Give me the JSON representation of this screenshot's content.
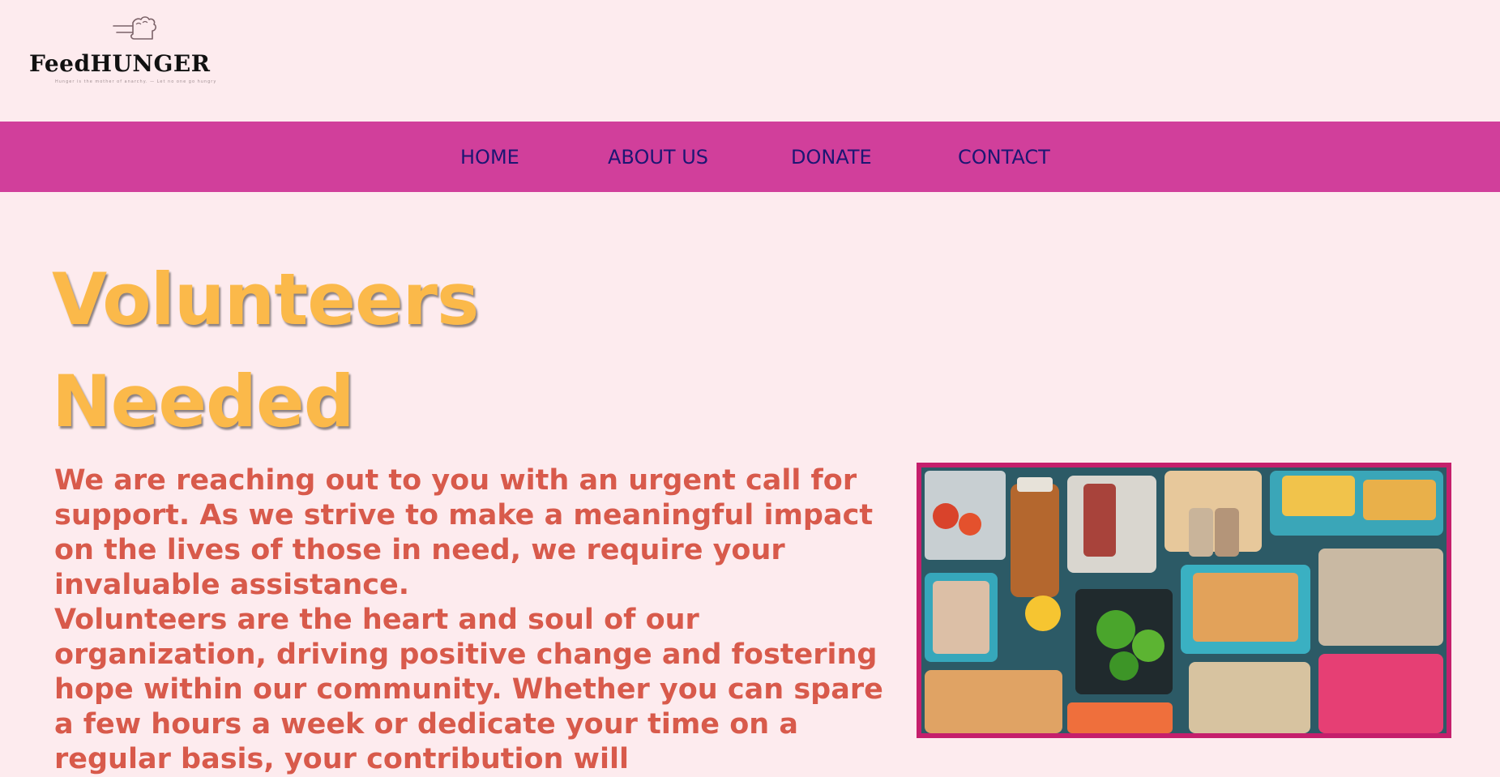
{
  "header": {
    "logo_text": "FeedHUNGER",
    "logo_tagline": "Hunger is the mother of anarchy. — Let no one go hungry",
    "logo_icon": "hand-feeding-icon"
  },
  "nav": {
    "items": [
      {
        "label": "HOME"
      },
      {
        "label": "ABOUT US"
      },
      {
        "label": "DONATE"
      },
      {
        "label": "CONTACT"
      }
    ]
  },
  "main": {
    "headline_line1": "Volunteers",
    "headline_line2": "Needed",
    "paragraph1": "We are reaching out to you with an urgent call for support. As we strive to make a meaningful impact on the lives of those in need, we require your invaluable assistance.",
    "paragraph2": "Volunteers are the heart and soul of our organization, driving positive change and fostering hope within our community. Whether you can spare a few hours a week or dedicate your time on a regular basis, your contribution will"
  },
  "colors": {
    "background": "#fdebee",
    "nav_bar": "#d13f9b",
    "nav_text": "#1c1673",
    "headline": "#fbb94a",
    "body_text": "#d85a4b",
    "image_border": "#c51f6c"
  },
  "image": {
    "subject": "food-packages-photo"
  }
}
